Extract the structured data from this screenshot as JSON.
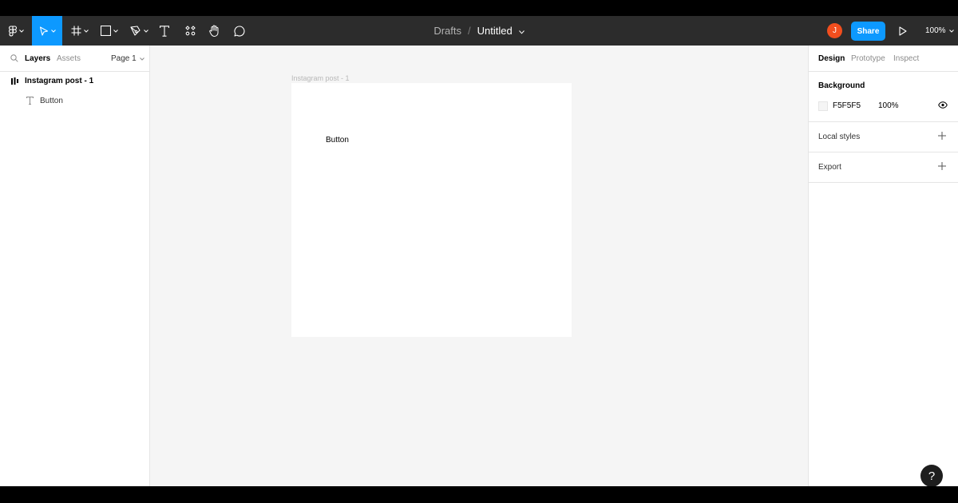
{
  "toolbar": {
    "breadcrumb_parent": "Drafts",
    "breadcrumb_separator": "/",
    "document_title": "Untitled",
    "avatar_initial": "J",
    "share_label": "Share",
    "zoom_label": "100%",
    "accent_color": "#0d99ff",
    "avatar_color": "#f24e1e",
    "tools": [
      "figma-menu-icon",
      "move-tool-icon",
      "frame-tool-icon",
      "rectangle-tool-icon",
      "pen-tool-icon",
      "text-tool-icon",
      "components-icon",
      "hand-tool-icon",
      "comment-icon"
    ]
  },
  "left_panel": {
    "tabs": {
      "layers": "Layers",
      "assets": "Assets"
    },
    "page_selector": "Page 1",
    "layers": [
      {
        "name": "Instagram post - 1",
        "type": "frame"
      },
      {
        "name": "Button",
        "type": "text"
      }
    ]
  },
  "canvas": {
    "frame_label": "Instagram post - 1",
    "text_layer": "Button"
  },
  "right_panel": {
    "tabs": {
      "design": "Design",
      "prototype": "Prototype",
      "inspect": "Inspect"
    },
    "background": {
      "heading": "Background",
      "color_hex": "F5F5F5",
      "opacity": "100%"
    },
    "local_styles_label": "Local styles",
    "export_label": "Export"
  },
  "help_label": "?"
}
